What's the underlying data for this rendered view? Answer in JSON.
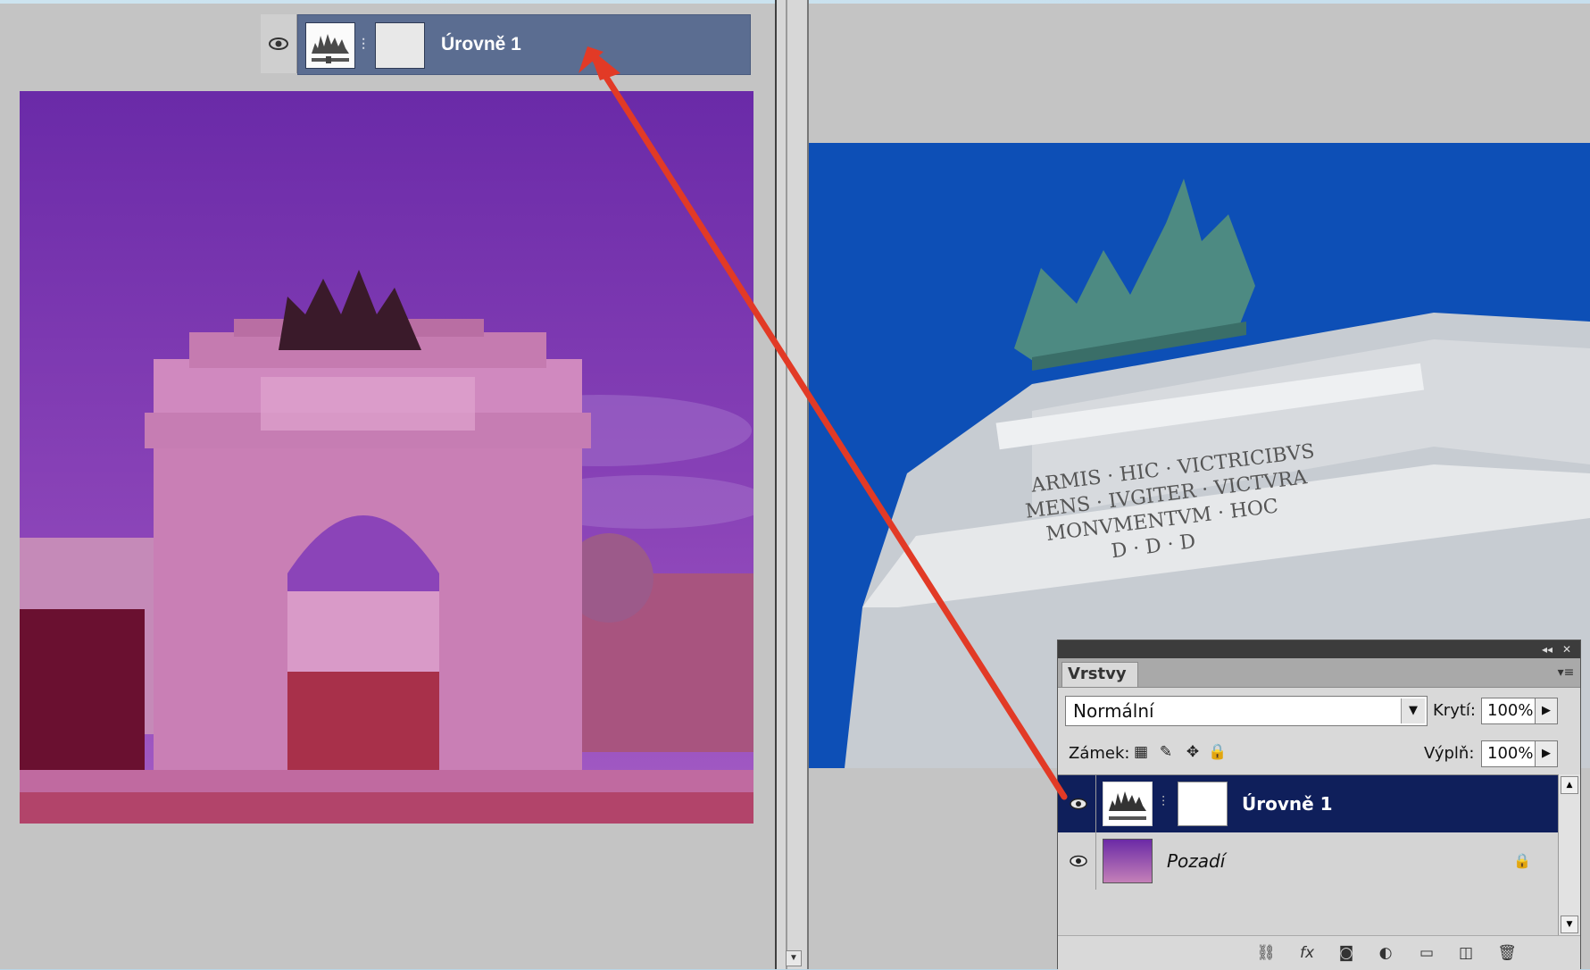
{
  "top_layer_preview": {
    "layer_name": "Úrovně 1"
  },
  "layers_panel": {
    "tab_label": "Vrstvy",
    "blend_mode": "Normální",
    "opacity_label": "Krytí:",
    "opacity_value": "100%",
    "lock_label": "Zámek:",
    "fill_label": "Výplň:",
    "fill_value": "100%",
    "layers": [
      {
        "name": "Úrovně 1",
        "selected": true,
        "type": "adjustment-levels"
      },
      {
        "name": "Pozadí",
        "selected": false,
        "type": "background",
        "locked": true
      }
    ],
    "footer_icons": [
      "link-icon",
      "fx-icon",
      "mask-icon",
      "adjustment-icon",
      "folder-icon",
      "new-layer-icon",
      "trash-icon"
    ]
  },
  "colors": {
    "selected_layer": "#0f1f5b",
    "preview_layer": "#5b6d91",
    "annotation_arrow": "#e23a26",
    "sky_left": "#7a2fb0",
    "sky_right": "#0d4fb6"
  }
}
